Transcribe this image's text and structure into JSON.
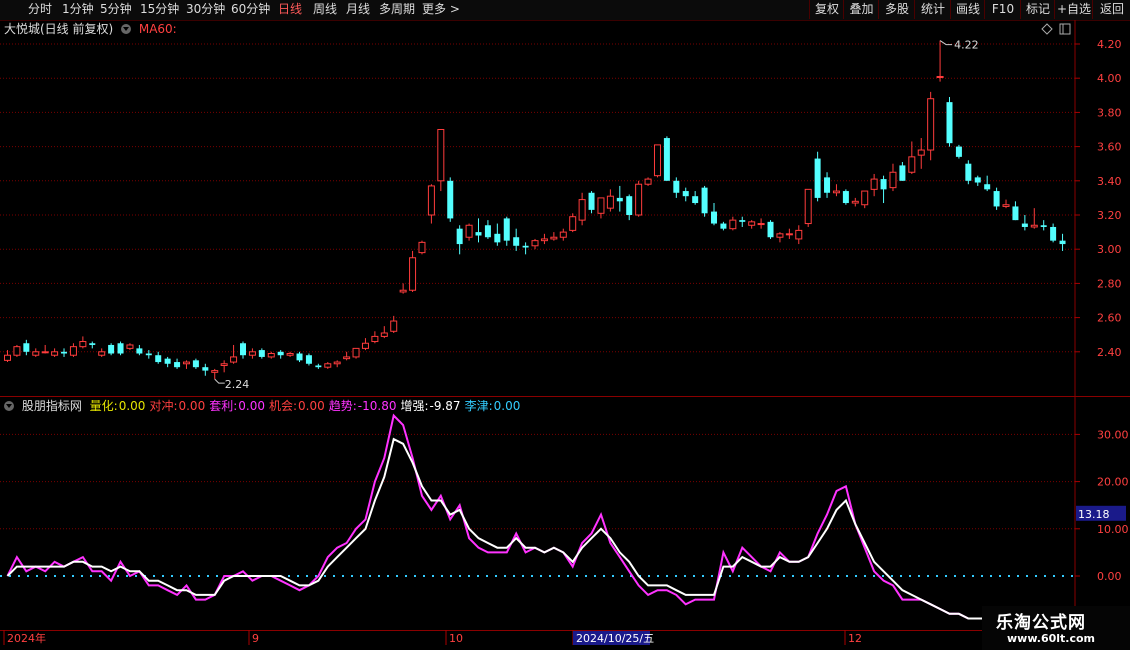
{
  "toolbar": {
    "periods": [
      "分时",
      "1分钟",
      "5分钟",
      "15分钟",
      "30分钟",
      "60分钟",
      "日线",
      "周线",
      "月线",
      "多周期",
      "更多 >"
    ],
    "active_period": "日线",
    "right_buttons": [
      "复权",
      "叠加",
      "多股",
      "统计",
      "画线",
      "F10",
      "标记",
      "+自选",
      "返回"
    ]
  },
  "header": {
    "stock_name": "大悦城(日线 前复权)",
    "ma_label": "MA60:"
  },
  "indicator": {
    "name": "股朋指标网",
    "fields": [
      {
        "label": "量化:",
        "value": "0.00",
        "color": "#e6e600"
      },
      {
        "label": "对冲:",
        "value": "0.00",
        "color": "#ff4040"
      },
      {
        "label": "套利:",
        "value": "0.00",
        "color": "#ff33ff"
      },
      {
        "label": "机会:",
        "value": "0.00",
        "color": "#ff4040"
      },
      {
        "label": "趋势:",
        "value": "-10.80",
        "color": "#ff33ff"
      },
      {
        "label": "增强:",
        "value": "-9.87",
        "color": "#ffffff"
      },
      {
        "label": "李津:",
        "value": "0.00",
        "color": "#33ccff"
      }
    ],
    "current_value_badge": "13.18"
  },
  "price_axis": {
    "labels": [
      "4.20",
      "4.00",
      "3.80",
      "3.60",
      "3.40",
      "3.20",
      "3.00",
      "2.80",
      "2.60",
      "2.40"
    ]
  },
  "indicator_axis": {
    "labels": [
      "30.00",
      "20.00",
      "10.00",
      "0.00"
    ]
  },
  "time_axis": {
    "labels": [
      "2024年",
      "9",
      "10",
      "2024/10/25/五",
      "12"
    ]
  },
  "annotations": {
    "high": "4.22",
    "low": "2.24"
  },
  "watermark": {
    "brand": "乐淘公式网",
    "url": "www.60lt.com"
  },
  "colors": {
    "up": "#ff3c3c",
    "down": "#54ffff",
    "grid": "#7a0000",
    "trend": "#ff33ff",
    "strength": "#ffffff"
  },
  "chart_data": {
    "type": "candlestick",
    "candles": [
      [
        2.35,
        2.41,
        2.34,
        2.38
      ],
      [
        2.38,
        2.44,
        2.37,
        2.43
      ],
      [
        2.45,
        2.47,
        2.38,
        2.4
      ],
      [
        2.38,
        2.42,
        2.37,
        2.4
      ],
      [
        2.4,
        2.44,
        2.39,
        2.4
      ],
      [
        2.38,
        2.42,
        2.37,
        2.4
      ],
      [
        2.4,
        2.42,
        2.37,
        2.39
      ],
      [
        2.38,
        2.45,
        2.37,
        2.43
      ],
      [
        2.43,
        2.49,
        2.42,
        2.46
      ],
      [
        2.45,
        2.46,
        2.42,
        2.44
      ],
      [
        2.38,
        2.42,
        2.37,
        2.4
      ],
      [
        2.44,
        2.45,
        2.38,
        2.39
      ],
      [
        2.45,
        2.46,
        2.38,
        2.39
      ],
      [
        2.42,
        2.45,
        2.41,
        2.44
      ],
      [
        2.42,
        2.44,
        2.38,
        2.39
      ],
      [
        2.39,
        2.41,
        2.36,
        2.38
      ],
      [
        2.38,
        2.4,
        2.33,
        2.34
      ],
      [
        2.36,
        2.37,
        2.31,
        2.33
      ],
      [
        2.34,
        2.36,
        2.3,
        2.31
      ],
      [
        2.33,
        2.35,
        2.3,
        2.34
      ],
      [
        2.35,
        2.36,
        2.3,
        2.31
      ],
      [
        2.31,
        2.33,
        2.26,
        2.29
      ],
      [
        2.28,
        2.3,
        2.24,
        2.29
      ],
      [
        2.32,
        2.35,
        2.28,
        2.33
      ],
      [
        2.34,
        2.44,
        2.33,
        2.37
      ],
      [
        2.45,
        2.46,
        2.36,
        2.38
      ],
      [
        2.38,
        2.42,
        2.36,
        2.4
      ],
      [
        2.41,
        2.42,
        2.36,
        2.37
      ],
      [
        2.37,
        2.4,
        2.36,
        2.39
      ],
      [
        2.4,
        2.41,
        2.36,
        2.38
      ],
      [
        2.38,
        2.4,
        2.37,
        2.39
      ],
      [
        2.39,
        2.4,
        2.34,
        2.35
      ],
      [
        2.38,
        2.39,
        2.32,
        2.33
      ],
      [
        2.32,
        2.33,
        2.3,
        2.31
      ],
      [
        2.31,
        2.34,
        2.3,
        2.33
      ],
      [
        2.33,
        2.35,
        2.31,
        2.34
      ],
      [
        2.36,
        2.4,
        2.35,
        2.37
      ],
      [
        2.37,
        2.42,
        2.36,
        2.42
      ],
      [
        2.42,
        2.48,
        2.41,
        2.45
      ],
      [
        2.46,
        2.52,
        2.45,
        2.49
      ],
      [
        2.49,
        2.55,
        2.48,
        2.51
      ],
      [
        2.52,
        2.61,
        2.51,
        2.58
      ],
      [
        2.75,
        2.8,
        2.74,
        2.76
      ],
      [
        2.76,
        2.99,
        2.75,
        2.95
      ],
      [
        2.98,
        3.05,
        2.97,
        3.04
      ],
      [
        3.2,
        3.38,
        3.15,
        3.37
      ],
      [
        3.4,
        3.7,
        3.34,
        3.7
      ],
      [
        3.4,
        3.42,
        3.16,
        3.18
      ],
      [
        3.12,
        3.14,
        2.97,
        3.03
      ],
      [
        3.07,
        3.15,
        3.05,
        3.14
      ],
      [
        3.1,
        3.18,
        3.04,
        3.08
      ],
      [
        3.14,
        3.17,
        3.06,
        3.07
      ],
      [
        3.09,
        3.15,
        3.02,
        3.04
      ],
      [
        3.18,
        3.19,
        3.02,
        3.05
      ],
      [
        3.07,
        3.12,
        2.99,
        3.02
      ],
      [
        3.02,
        3.04,
        2.97,
        3.01
      ],
      [
        3.02,
        3.06,
        3.0,
        3.05
      ],
      [
        3.05,
        3.09,
        3.03,
        3.06
      ],
      [
        3.06,
        3.1,
        3.05,
        3.07
      ],
      [
        3.07,
        3.12,
        3.05,
        3.1
      ],
      [
        3.11,
        3.21,
        3.1,
        3.19
      ],
      [
        3.17,
        3.33,
        3.14,
        3.29
      ],
      [
        3.33,
        3.34,
        3.21,
        3.23
      ],
      [
        3.21,
        3.3,
        3.18,
        3.3
      ],
      [
        3.24,
        3.35,
        3.22,
        3.31
      ],
      [
        3.3,
        3.37,
        3.22,
        3.28
      ],
      [
        3.31,
        3.32,
        3.17,
        3.2
      ],
      [
        3.2,
        3.4,
        3.19,
        3.38
      ],
      [
        3.38,
        3.42,
        3.37,
        3.41
      ],
      [
        3.43,
        3.61,
        3.42,
        3.61
      ],
      [
        3.65,
        3.66,
        3.4,
        3.4
      ],
      [
        3.4,
        3.42,
        3.3,
        3.33
      ],
      [
        3.34,
        3.36,
        3.28,
        3.31
      ],
      [
        3.31,
        3.34,
        3.26,
        3.27
      ],
      [
        3.36,
        3.37,
        3.19,
        3.21
      ],
      [
        3.22,
        3.27,
        3.14,
        3.15
      ],
      [
        3.15,
        3.16,
        3.11,
        3.12
      ],
      [
        3.12,
        3.19,
        3.11,
        3.17
      ],
      [
        3.17,
        3.19,
        3.13,
        3.16
      ],
      [
        3.14,
        3.17,
        3.12,
        3.16
      ],
      [
        3.15,
        3.18,
        3.12,
        3.15
      ],
      [
        3.16,
        3.17,
        3.06,
        3.07
      ],
      [
        3.07,
        3.1,
        3.04,
        3.09
      ],
      [
        3.09,
        3.12,
        3.06,
        3.09
      ],
      [
        3.06,
        3.14,
        3.03,
        3.11
      ],
      [
        3.15,
        3.35,
        3.13,
        3.35
      ],
      [
        3.53,
        3.57,
        3.28,
        3.3
      ],
      [
        3.42,
        3.45,
        3.3,
        3.33
      ],
      [
        3.33,
        3.38,
        3.31,
        3.34
      ],
      [
        3.34,
        3.35,
        3.26,
        3.27
      ],
      [
        3.27,
        3.3,
        3.25,
        3.28
      ],
      [
        3.26,
        3.34,
        3.24,
        3.34
      ],
      [
        3.35,
        3.44,
        3.31,
        3.41
      ],
      [
        3.41,
        3.43,
        3.27,
        3.35
      ],
      [
        3.36,
        3.5,
        3.34,
        3.45
      ],
      [
        3.49,
        3.51,
        3.4,
        3.4
      ],
      [
        3.45,
        3.63,
        3.44,
        3.54
      ],
      [
        3.55,
        3.65,
        3.47,
        3.58
      ],
      [
        3.58,
        3.92,
        3.52,
        3.88
      ],
      [
        4.01,
        4.22,
        3.98,
        4.01
      ],
      [
        3.86,
        3.89,
        3.6,
        3.62
      ],
      [
        3.6,
        3.61,
        3.53,
        3.54
      ],
      [
        3.5,
        3.52,
        3.38,
        3.4
      ],
      [
        3.42,
        3.43,
        3.37,
        3.39
      ],
      [
        3.38,
        3.43,
        3.34,
        3.35
      ],
      [
        3.34,
        3.36,
        3.23,
        3.25
      ],
      [
        3.25,
        3.29,
        3.24,
        3.26
      ],
      [
        3.25,
        3.28,
        3.17,
        3.17
      ],
      [
        3.15,
        3.2,
        3.11,
        3.13
      ],
      [
        3.13,
        3.24,
        3.12,
        3.14
      ],
      [
        3.14,
        3.17,
        3.11,
        3.13
      ],
      [
        3.13,
        3.15,
        3.04,
        3.05
      ],
      [
        3.05,
        3.09,
        2.99,
        3.03
      ]
    ],
    "indicator_series": [
      {
        "name": "趋势",
        "values": [
          0,
          4,
          1,
          2,
          1,
          3,
          2,
          3,
          4,
          1,
          1,
          -1,
          3,
          0,
          1,
          -2,
          -2,
          -3,
          -4,
          -2,
          -5,
          -5,
          -4,
          0,
          0,
          1,
          -1,
          0,
          0,
          -1,
          -2,
          -3,
          -2,
          0,
          4,
          6,
          7,
          10,
          12,
          20,
          25,
          34,
          32,
          25,
          17,
          14,
          17,
          12,
          15,
          8,
          6,
          5,
          5,
          5,
          9,
          5,
          6,
          5,
          6,
          5,
          2,
          7,
          9,
          13,
          7,
          4,
          1,
          -2,
          -4,
          -3,
          -3,
          -4,
          -6,
          -5,
          -5,
          -5,
          5,
          1,
          6,
          4,
          2,
          1,
          5,
          3,
          3,
          4,
          9,
          13,
          18,
          19,
          11,
          6,
          1,
          -1,
          -2,
          -5,
          -5,
          -5,
          -6,
          -7,
          -8,
          -8,
          -9,
          -9,
          -9,
          -9,
          -9,
          -10,
          -10,
          -10,
          -10,
          -10,
          -10,
          -10,
          -10,
          -11,
          -11,
          -11,
          -11
        ]
      },
      {
        "name": "增强",
        "values": [
          0,
          2,
          2,
          2,
          2,
          2,
          2,
          3,
          3,
          2,
          2,
          1,
          2,
          1,
          1,
          -1,
          -1,
          -2,
          -3,
          -3,
          -4,
          -4,
          -4,
          -1,
          0,
          0,
          0,
          0,
          0,
          0,
          -1,
          -2,
          -2,
          -1,
          2,
          4,
          6,
          8,
          10,
          16,
          21,
          29,
          28,
          24,
          19,
          16,
          16,
          13,
          14,
          10,
          8,
          7,
          6,
          6,
          8,
          6,
          6,
          5,
          6,
          5,
          3,
          6,
          8,
          10,
          8,
          5,
          3,
          0,
          -2,
          -2,
          -2,
          -3,
          -4,
          -4,
          -4,
          -4,
          2,
          2,
          4,
          3,
          2,
          2,
          4,
          3,
          3,
          4,
          7,
          10,
          14,
          16,
          11,
          7,
          3,
          1,
          -1,
          -3,
          -4,
          -5,
          -6,
          -7,
          -8,
          -8,
          -9,
          -9,
          -9,
          -9,
          -9,
          -9,
          -10,
          -10,
          -10,
          -10,
          -10,
          -10,
          -10,
          -10,
          -10,
          -10,
          -10
        ]
      }
    ],
    "price_range": [
      2.2,
      4.3
    ],
    "indicator_range": [
      -10,
      35
    ]
  }
}
